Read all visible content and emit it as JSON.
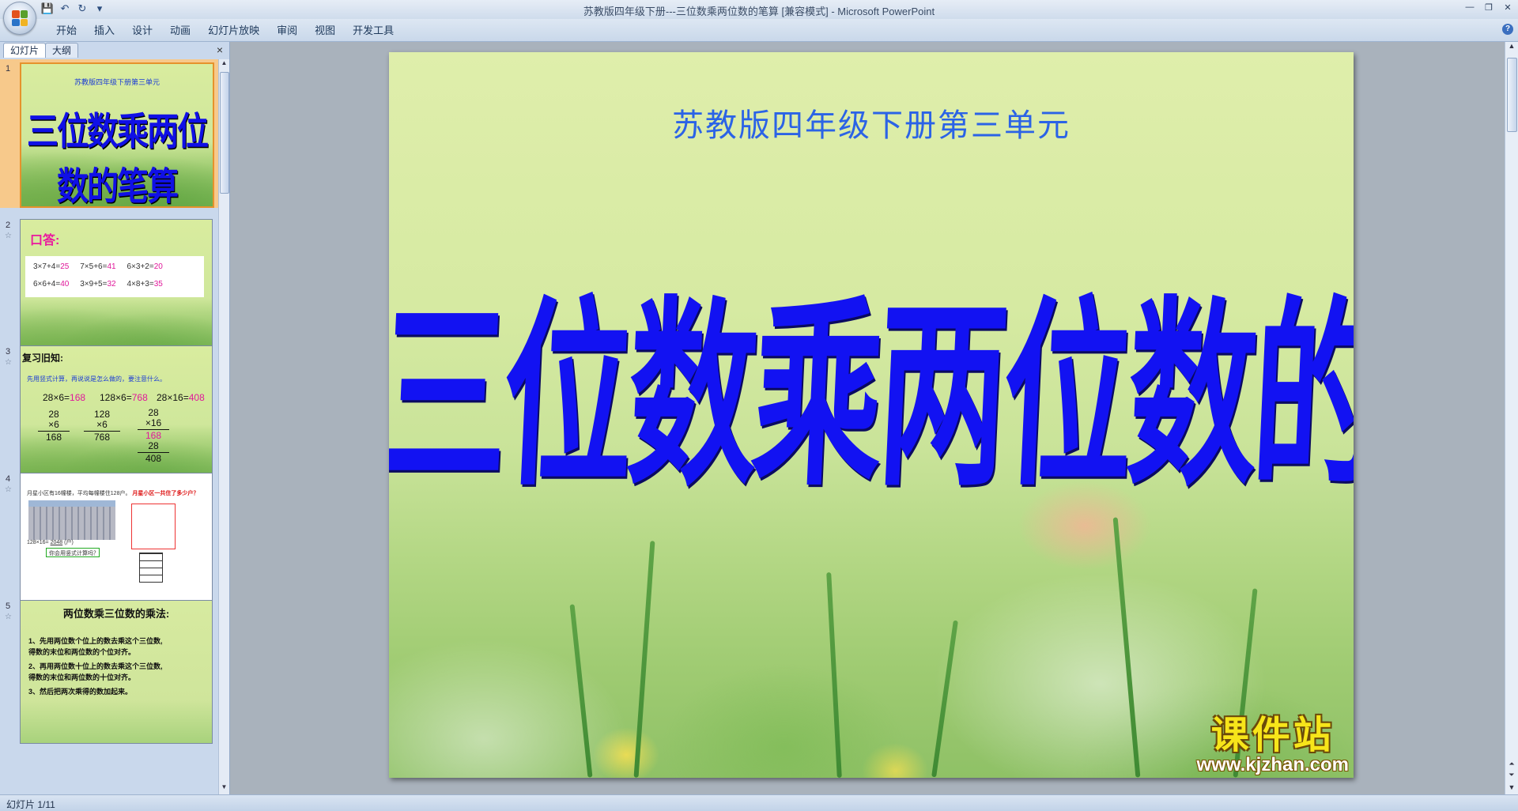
{
  "window": {
    "title": "苏教版四年级下册---三位数乘两位数的笔算 [兼容模式] - Microsoft PowerPoint"
  },
  "ribbon": {
    "tabs": [
      "开始",
      "插入",
      "设计",
      "动画",
      "幻灯片放映",
      "审阅",
      "视图",
      "开发工具"
    ]
  },
  "panel": {
    "tabs": [
      "幻灯片",
      "大纲"
    ],
    "close_label": "×"
  },
  "thumbnails": [
    {
      "num": "1",
      "subtitle": "苏教版四年级下册第三单元",
      "title": "三位数乘两位数的笔算"
    },
    {
      "num": "2",
      "heading": "口答:",
      "rows": [
        [
          {
            "q": "3×7+4=",
            "a": "25"
          },
          {
            "q": "7×5+6=",
            "a": "41"
          },
          {
            "q": "6×3+2=",
            "a": "20"
          }
        ],
        [
          {
            "q": "6×6+4=",
            "a": "40"
          },
          {
            "q": "3×9+5=",
            "a": "32"
          },
          {
            "q": "4×8+3=",
            "a": "35"
          }
        ]
      ]
    },
    {
      "num": "3",
      "heading": "复习旧知:",
      "sub": "先用竖式计算，再说说是怎么做的，要注意什么。",
      "eqs": [
        {
          "q": "28×6=",
          "a": "168"
        },
        {
          "q": "128×6=",
          "a": "768"
        },
        {
          "q": "28×16=",
          "a": "408"
        }
      ],
      "cols": [
        [
          "28",
          "×6",
          "168"
        ],
        [
          "128",
          "×6",
          "768"
        ],
        [
          "28",
          "×16",
          "168",
          "28",
          "408"
        ]
      ]
    },
    {
      "num": "4",
      "line1": "月星小区有16幢楼，平均每幢楼住128户。",
      "question": "月星小区一共住了多少户？",
      "eq": "128×16=",
      "answer": "2048",
      "unit": "(户)",
      "prompt": "你会用竖式计算吗？"
    },
    {
      "num": "5",
      "heading": "两位数乘三位数的乘法:",
      "steps": [
        "1、先用两位数个位上的数去乘这个三位数,",
        "得数的末位和两位数的个位对齐。",
        "2、再用两位数十位上的数去乘这个三位数,",
        "得数的末位和两位数的十位对齐。",
        "3、然后把两次乘得的数加起来。"
      ]
    }
  ],
  "slide": {
    "subtitle": "苏教版四年级下册第三单元",
    "title": "三位数乘两位数的笔算"
  },
  "watermark": {
    "brand": "课件站",
    "url": "www.kjzhan.com"
  },
  "status": {
    "slide_counter": "幻灯片 1/11"
  },
  "colors": {
    "title_blue": "#1212f2",
    "subtitle_blue": "#2b63e6",
    "answer_pink": "#e0189a",
    "selected_thumb": "#f7c98b"
  }
}
